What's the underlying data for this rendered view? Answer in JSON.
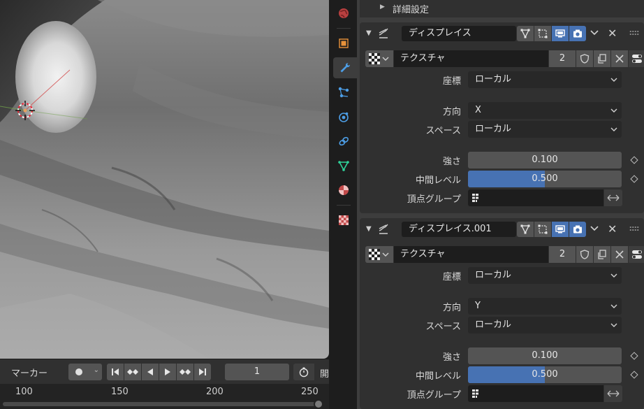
{
  "timeline": {
    "marker_menu": "マーカー",
    "current_frame": "1",
    "cutoff_label": "開",
    "ruler_ticks": [
      "100",
      "150",
      "200",
      "250"
    ]
  },
  "properties_tabs": [
    {
      "name": "world-tab",
      "icon": "world-icon",
      "active": false
    },
    {
      "name": "object-tab",
      "icon": "object-icon",
      "active": false
    },
    {
      "name": "modifier-tab",
      "icon": "wrench-icon",
      "active": true
    },
    {
      "name": "particles-tab",
      "icon": "particles-icon",
      "active": false
    },
    {
      "name": "physics-tab",
      "icon": "physics-icon",
      "active": false
    },
    {
      "name": "constraints-tab",
      "icon": "constraints-icon",
      "active": false
    },
    {
      "name": "data-tab",
      "icon": "mesh-data-icon",
      "active": false
    },
    {
      "name": "material-tab",
      "icon": "material-icon",
      "active": false
    },
    {
      "name": "texture-tab",
      "icon": "texture-icon",
      "active": false
    }
  ],
  "advanced_settings_label": "詳細設定",
  "modifiers": [
    {
      "name": "ディスプレイス",
      "texture_name": "テクスチャ",
      "texture_users": "2",
      "coords_label": "座標",
      "coords_value": "ローカル",
      "direction_label": "方向",
      "direction_value": "X",
      "space_label": "スペース",
      "space_value": "ローカル",
      "strength_label": "強さ",
      "strength_value": "0.100",
      "midlevel_label": "中間レベル",
      "midlevel_value": "0.500",
      "midlevel_fraction": 0.5,
      "vgroup_label": "頂点グループ"
    },
    {
      "name": "ディスプレイス.001",
      "texture_name": "テクスチャ",
      "texture_users": "2",
      "coords_label": "座標",
      "coords_value": "ローカル",
      "direction_label": "方向",
      "direction_value": "Y",
      "space_label": "スペース",
      "space_value": "ローカル",
      "strength_label": "強さ",
      "strength_value": "0.100",
      "midlevel_label": "中間レベル",
      "midlevel_value": "0.500",
      "midlevel_fraction": 0.5,
      "vgroup_label": "頂点グループ"
    }
  ],
  "colors": {
    "accent": "#4772b3",
    "panel_bg": "#303030",
    "editor_bg": "#3d3d3d"
  }
}
